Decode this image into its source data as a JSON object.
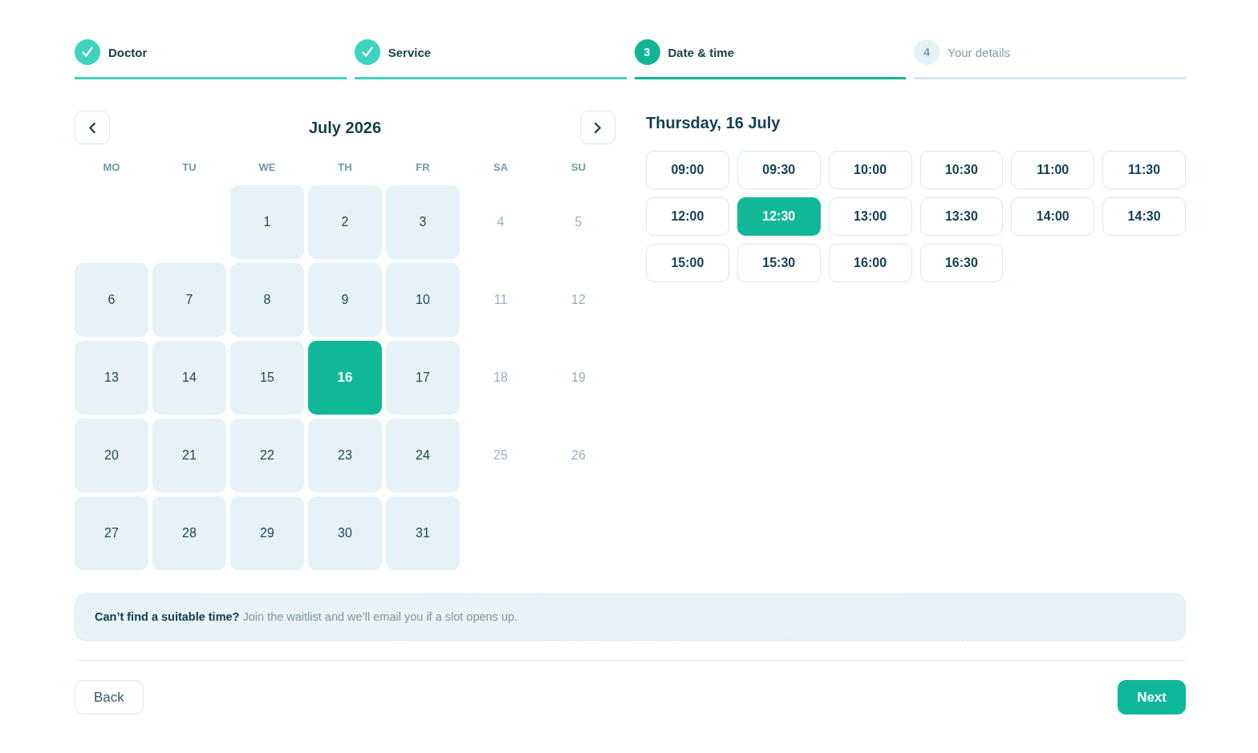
{
  "steps": [
    {
      "label": "Doctor",
      "completed": true,
      "selected": false
    },
    {
      "label": "Service",
      "completed": true,
      "selected": false
    },
    {
      "number": "3",
      "label": "Date & time",
      "completed": false,
      "selected": true
    },
    {
      "number": "4",
      "label": "Your details",
      "completed": false,
      "selected": false
    }
  ],
  "calendar": {
    "title": "July 2026",
    "weekdays": [
      "MO",
      "TU",
      "WE",
      "TH",
      "FR",
      "SA",
      "SU"
    ],
    "weeks": [
      [
        {
          "label": "1",
          "disabled": false,
          "selected": false
        },
        {
          "label": "2",
          "disabled": false,
          "selected": false
        },
        {
          "label": "3",
          "disabled": false,
          "selected": false
        },
        {
          "label": "4",
          "disabled": true,
          "selected": false
        },
        {
          "label": "5",
          "disabled": true,
          "selected": false
        }
      ],
      [
        {
          "label": "6",
          "disabled": false,
          "selected": false
        },
        {
          "label": "7",
          "disabled": false,
          "selected": false
        },
        {
          "label": "8",
          "disabled": false,
          "selected": false
        },
        {
          "label": "9",
          "disabled": false,
          "selected": false
        },
        {
          "label": "10",
          "disabled": false,
          "selected": false
        },
        {
          "label": "11",
          "disabled": true,
          "selected": false
        },
        {
          "label": "12",
          "disabled": true,
          "selected": false
        }
      ],
      [
        {
          "label": "13",
          "disabled": false,
          "selected": false
        },
        {
          "label": "14",
          "disabled": false,
          "selected": false
        },
        {
          "label": "15",
          "disabled": false,
          "selected": false
        },
        {
          "label": "16",
          "disabled": false,
          "selected": true
        },
        {
          "label": "17",
          "disabled": false,
          "selected": false
        },
        {
          "label": "18",
          "disabled": true,
          "selected": false
        },
        {
          "label": "19",
          "disabled": true,
          "selected": false
        }
      ],
      [
        {
          "label": "20",
          "disabled": false,
          "selected": false
        },
        {
          "label": "21",
          "disabled": false,
          "selected": false
        },
        {
          "label": "22",
          "disabled": false,
          "selected": false
        },
        {
          "label": "23",
          "disabled": false,
          "selected": false
        },
        {
          "label": "24",
          "disabled": false,
          "selected": false
        },
        {
          "label": "25",
          "disabled": true,
          "selected": false
        },
        {
          "label": "26",
          "disabled": true,
          "selected": false
        }
      ],
      [
        {
          "label": "27",
          "disabled": false,
          "selected": false
        },
        {
          "label": "28",
          "disabled": false,
          "selected": false
        },
        {
          "label": "29",
          "disabled": false,
          "selected": false
        },
        {
          "label": "30",
          "disabled": false,
          "selected": false
        },
        {
          "label": "31",
          "disabled": false,
          "selected": false
        }
      ]
    ]
  },
  "times": {
    "title": "Thursday, 16 July",
    "slots": [
      {
        "label": "09:00",
        "selected": false
      },
      {
        "label": "09:30",
        "selected": false
      },
      {
        "label": "10:00",
        "selected": false
      },
      {
        "label": "10:30",
        "selected": false
      },
      {
        "label": "11:00",
        "selected": false
      },
      {
        "label": "11:30",
        "selected": false
      },
      {
        "label": "12:00",
        "selected": false
      },
      {
        "label": "12:30",
        "selected": true
      },
      {
        "label": "13:00",
        "selected": false
      },
      {
        "label": "13:30",
        "selected": false
      },
      {
        "label": "14:00",
        "selected": false
      },
      {
        "label": "14:30",
        "selected": false
      },
      {
        "label": "15:00",
        "selected": false
      },
      {
        "label": "15:30",
        "selected": false
      },
      {
        "label": "16:00",
        "selected": false
      },
      {
        "label": "16:30",
        "selected": false
      }
    ]
  },
  "notice": {
    "text": "**Can’t find a suitable time?** Join the waitlist and we’ll email you if a slot opens up."
  },
  "actions": [
    {
      "label": "Back",
      "kind": "secondary"
    },
    {
      "label": "Next",
      "kind": "primary"
    }
  ]
}
